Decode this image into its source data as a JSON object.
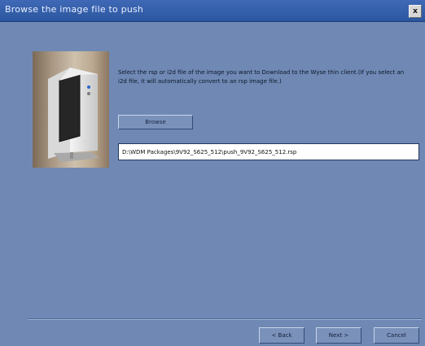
{
  "window": {
    "title": "Browse the image file to push",
    "close_glyph": "x"
  },
  "content": {
    "instructions": "Select the rsp or i2d file of the image you want to Download to the Wyse thin client.(If you select an i2d file, it will automatically convert to an rsp image file.)",
    "browse_label": "Browse",
    "file_path": "D:\\WDM Packages\\9V92_S625_512\\push_9V92_S625_512.rsp"
  },
  "footer": {
    "back_label": "< Back",
    "next_label": "Next >",
    "cancel_label": "Cancel"
  },
  "colors": {
    "titlebar": "#2b569f",
    "background": "#6f89b4",
    "button": "#7a91ba"
  },
  "icons": {
    "close": "close-icon",
    "device": "thin-client-device-image"
  }
}
